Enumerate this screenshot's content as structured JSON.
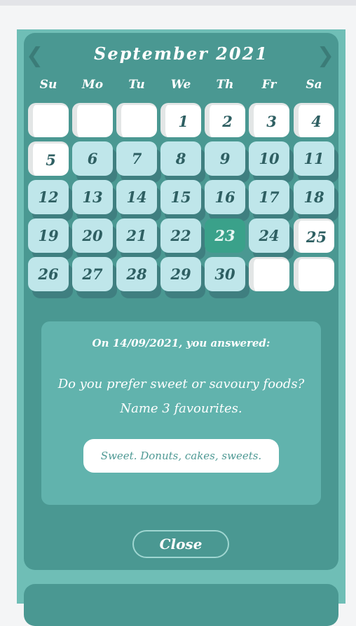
{
  "calendar": {
    "month_title": "September 2021",
    "prev_arrow": "❮",
    "next_arrow": "❯",
    "weekdays": [
      "Su",
      "Mo",
      "Tu",
      "We",
      "Th",
      "Fr",
      "Sa"
    ],
    "weeks": [
      [
        {
          "day": "",
          "state": "empty"
        },
        {
          "day": "",
          "state": "empty"
        },
        {
          "day": "",
          "state": "empty"
        },
        {
          "day": "1",
          "state": "white"
        },
        {
          "day": "2",
          "state": "white"
        },
        {
          "day": "3",
          "state": "white"
        },
        {
          "day": "4",
          "state": "white"
        }
      ],
      [
        {
          "day": "5",
          "state": "white"
        },
        {
          "day": "6",
          "state": "normal"
        },
        {
          "day": "7",
          "state": "normal"
        },
        {
          "day": "8",
          "state": "normal"
        },
        {
          "day": "9",
          "state": "normal"
        },
        {
          "day": "10",
          "state": "normal"
        },
        {
          "day": "11",
          "state": "normal"
        }
      ],
      [
        {
          "day": "12",
          "state": "normal"
        },
        {
          "day": "13",
          "state": "normal"
        },
        {
          "day": "14",
          "state": "normal"
        },
        {
          "day": "15",
          "state": "normal"
        },
        {
          "day": "16",
          "state": "normal"
        },
        {
          "day": "17",
          "state": "normal"
        },
        {
          "day": "18",
          "state": "normal"
        }
      ],
      [
        {
          "day": "19",
          "state": "normal"
        },
        {
          "day": "20",
          "state": "normal"
        },
        {
          "day": "21",
          "state": "normal"
        },
        {
          "day": "22",
          "state": "normal"
        },
        {
          "day": "23",
          "state": "selected"
        },
        {
          "day": "24",
          "state": "normal"
        },
        {
          "day": "25",
          "state": "white"
        }
      ],
      [
        {
          "day": "26",
          "state": "normal"
        },
        {
          "day": "27",
          "state": "normal"
        },
        {
          "day": "28",
          "state": "normal"
        },
        {
          "day": "29",
          "state": "normal"
        },
        {
          "day": "30",
          "state": "normal"
        },
        {
          "day": "",
          "state": "empty"
        },
        {
          "day": "",
          "state": "empty"
        }
      ]
    ]
  },
  "answer": {
    "date_text": "On 14/09/2021, you answered:",
    "question_line1": "Do you prefer sweet or savoury foods?",
    "question_line2": "Name 3 favourites.",
    "answer_text": "Sweet. Donuts, cakes, sweets."
  },
  "close_label": "Close",
  "colors": {
    "panel": "#4a9892",
    "outer": "#6fbeb6",
    "day_cell": "#bfe6ea",
    "selected_cell": "#3aa18a",
    "answer_box": "#61b3ad"
  }
}
